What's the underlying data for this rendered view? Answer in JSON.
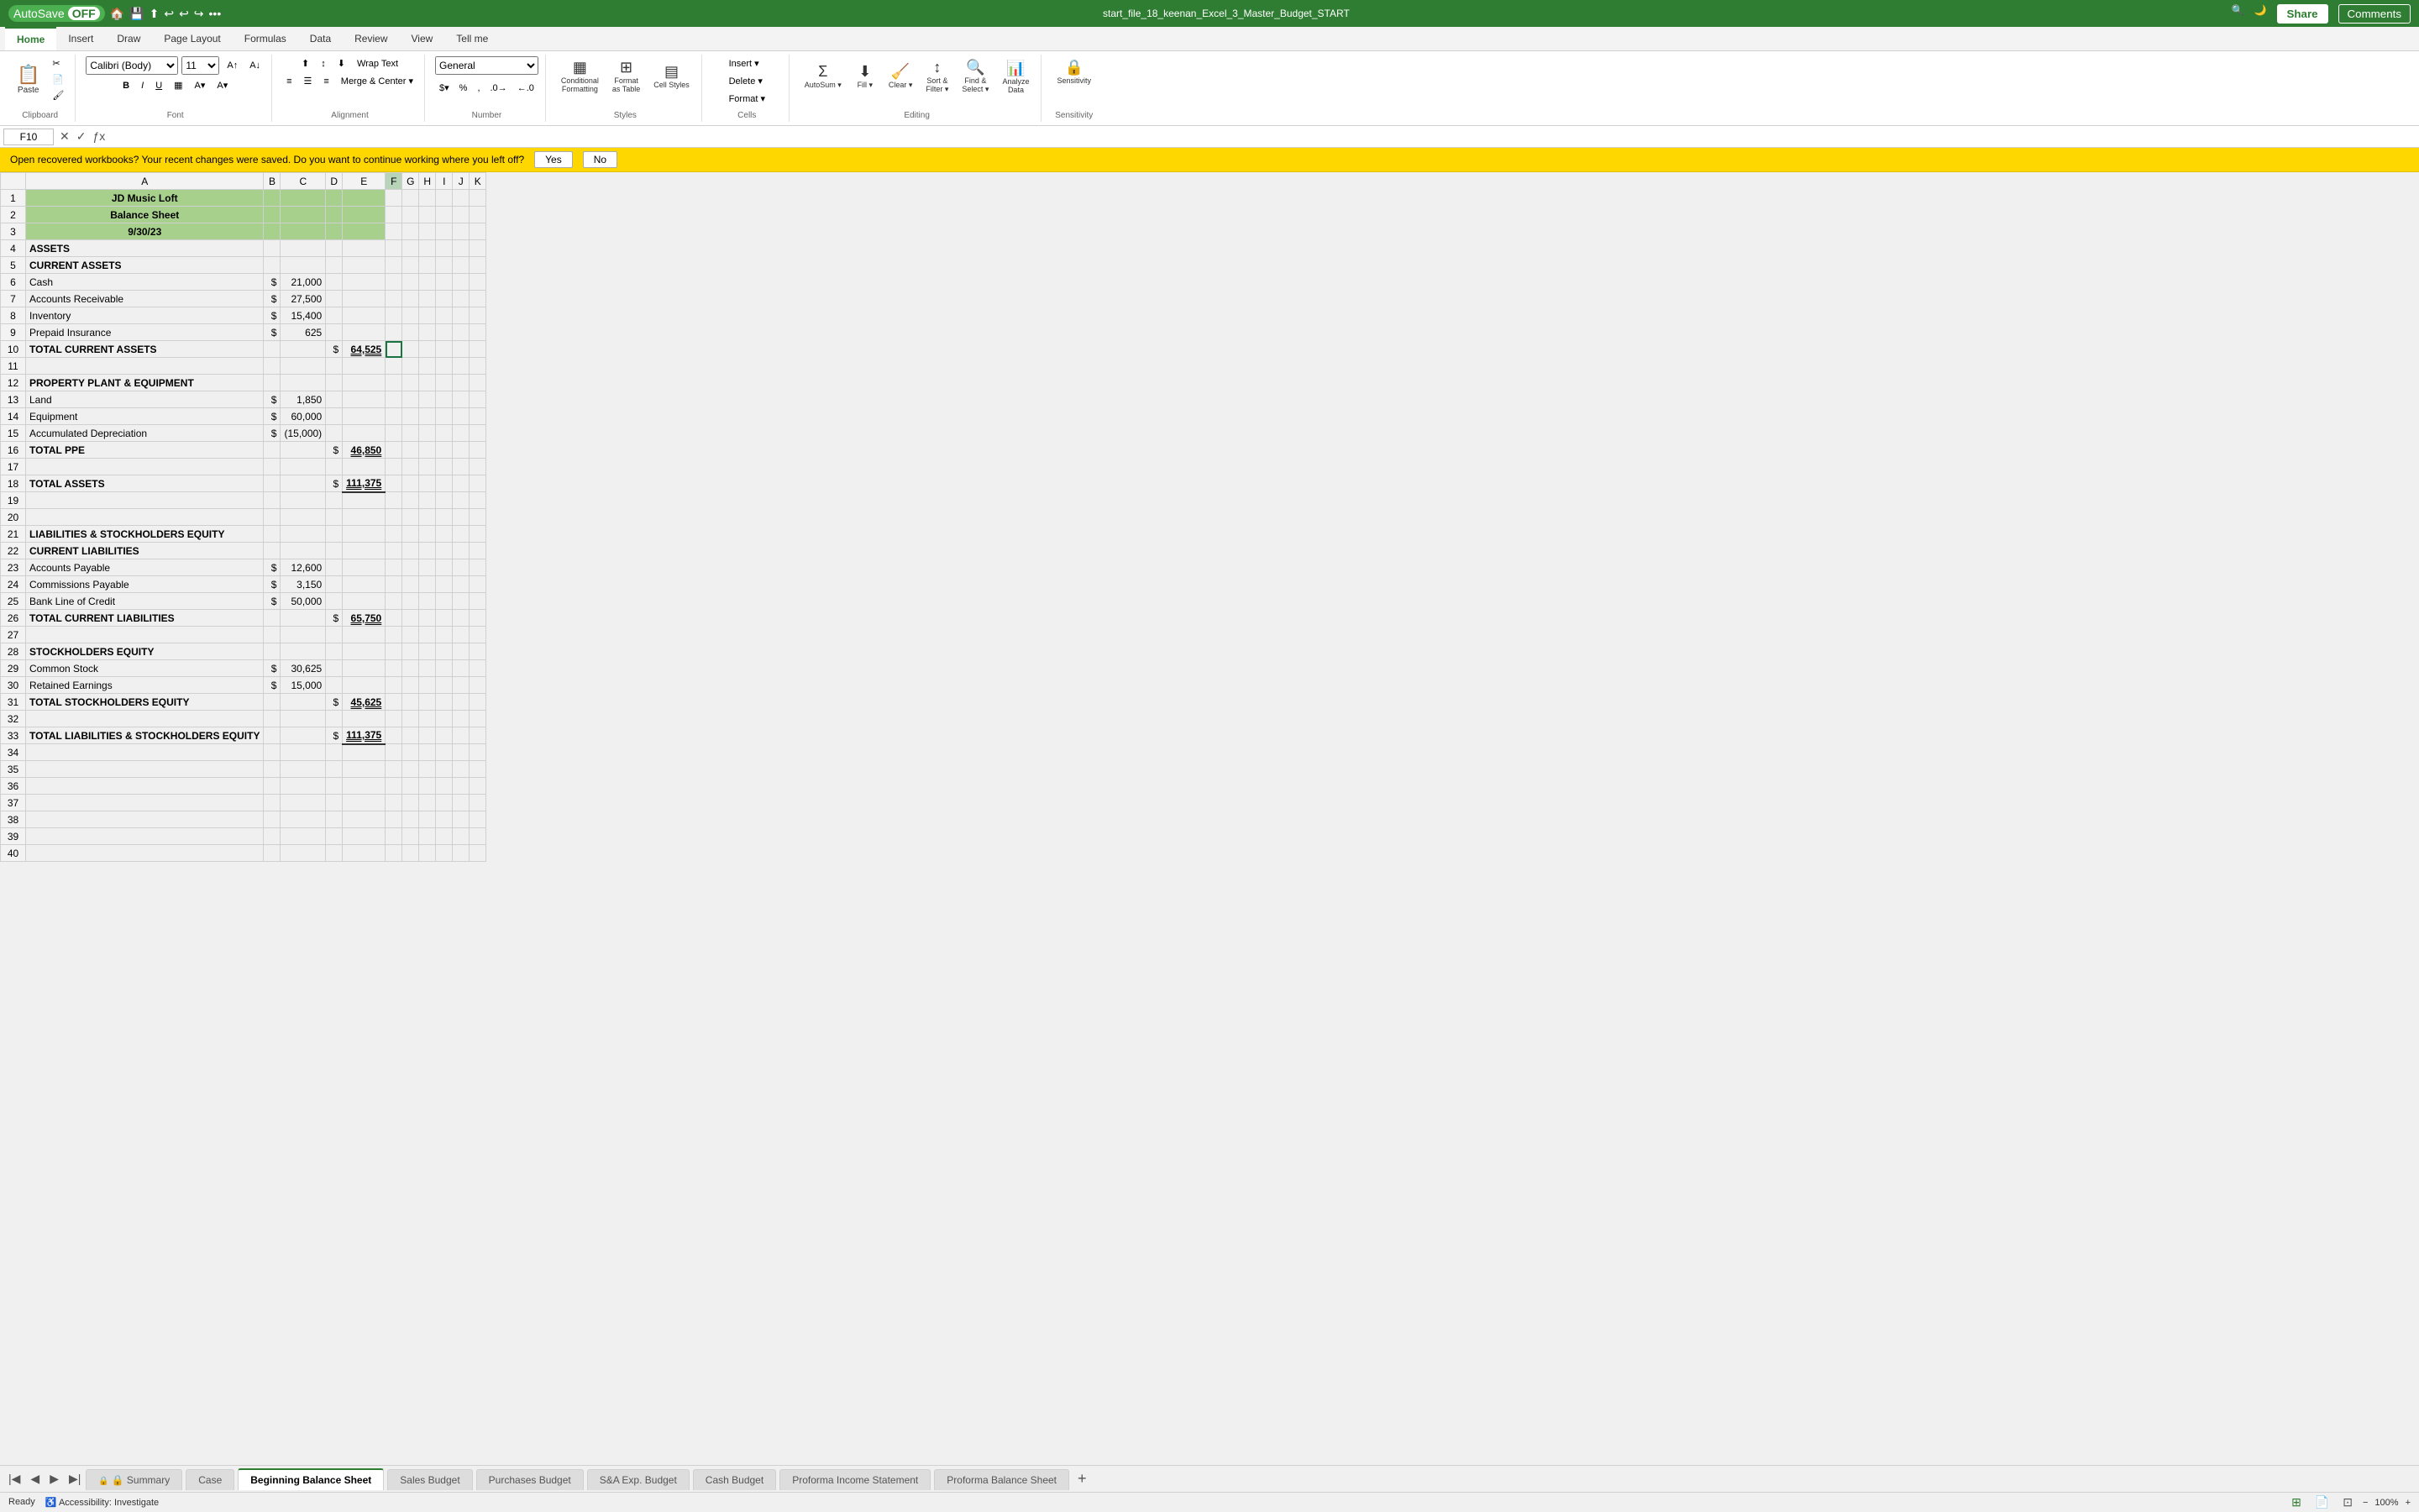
{
  "titlebar": {
    "autosave_label": "AutoSave",
    "autosave_state": "OFF",
    "filename": "start_file_18_keenan_Excel_3_Master_Budget_START",
    "share_label": "Share",
    "comments_label": "Comments"
  },
  "ribbon": {
    "tabs": [
      "Home",
      "Insert",
      "Draw",
      "Page Layout",
      "Formulas",
      "Data",
      "Review",
      "View",
      "Tell me"
    ],
    "active_tab": "Home",
    "groups": {
      "clipboard": "Clipboard",
      "font": "Font",
      "alignment": "Alignment",
      "number": "Number",
      "styles": "Styles",
      "cells": "Cells",
      "editing": "Editing",
      "sensitivity": "Sensitivity"
    },
    "buttons": {
      "paste": "Paste",
      "wrap_text": "Wrap Text",
      "merge_center": "Merge & Center",
      "conditional_formatting": "Conditional Formatting",
      "format_as_table": "Format as Table",
      "cell_styles": "Cell Styles",
      "insert": "Insert",
      "delete": "Delete",
      "format": "Format",
      "sort_filter": "Sort & Filter",
      "find_select": "Find & Select",
      "analyze_data": "Analyze Data",
      "sensitivity": "Sensitivity"
    }
  },
  "formulabar": {
    "cell_ref": "F10",
    "formula": ""
  },
  "notification": {
    "text": "Open recovered workbooks?  Your recent changes were saved. Do you want to continue working where you left off?",
    "yes_label": "Yes",
    "no_label": "No"
  },
  "sheet": {
    "columns": [
      "A",
      "B",
      "C",
      "D",
      "E",
      "F",
      "G",
      "H",
      "I",
      "J",
      "K"
    ],
    "rows": [
      {
        "num": 1,
        "cells": {
          "A": "JD Music Loft",
          "A_align": "center",
          "A_bold": true,
          "A_colspan": 5,
          "bg": "header-green"
        }
      },
      {
        "num": 2,
        "cells": {
          "A": "Balance Sheet",
          "A_align": "center",
          "A_bold": true,
          "A_colspan": 5,
          "bg": "header-green"
        }
      },
      {
        "num": 3,
        "cells": {
          "A": "9/30/23",
          "A_align": "center",
          "A_bold": true,
          "A_colspan": 5,
          "bg": "header-green"
        }
      },
      {
        "num": 4,
        "cells": {
          "A": "ASSETS",
          "A_bold": true
        }
      },
      {
        "num": 5,
        "cells": {
          "A": "CURRENT ASSETS",
          "A_bold": true
        }
      },
      {
        "num": 6,
        "cells": {
          "A": "Cash",
          "B": "$",
          "B_align": "right",
          "C": "21,000",
          "C_align": "right"
        }
      },
      {
        "num": 7,
        "cells": {
          "A": "Accounts Receivable",
          "B": "$",
          "B_align": "right",
          "C": "27,500",
          "C_align": "right"
        }
      },
      {
        "num": 8,
        "cells": {
          "A": "Inventory",
          "B": "$",
          "B_align": "right",
          "C": "15,400",
          "C_align": "right"
        }
      },
      {
        "num": 9,
        "cells": {
          "A": "Prepaid Insurance",
          "B": "$",
          "B_align": "right",
          "C": "625",
          "C_align": "right"
        }
      },
      {
        "num": 10,
        "cells": {
          "A": "TOTAL CURRENT ASSETS",
          "A_bold": true,
          "D": "$",
          "D_align": "right",
          "E": "64,525",
          "E_align": "right",
          "E_bold": true,
          "E_underline": true
        }
      },
      {
        "num": 11,
        "cells": {}
      },
      {
        "num": 12,
        "cells": {
          "A": "PROPERTY PLANT & EQUIPMENT",
          "A_bold": true
        }
      },
      {
        "num": 13,
        "cells": {
          "A": "Land",
          "B": "$",
          "B_align": "right",
          "C": "1,850",
          "C_align": "right"
        }
      },
      {
        "num": 14,
        "cells": {
          "A": "Equipment",
          "B": "$",
          "B_align": "right",
          "C": "60,000",
          "C_align": "right"
        }
      },
      {
        "num": 15,
        "cells": {
          "A": "Accumulated Depreciation",
          "B": "$",
          "B_align": "right",
          "C": "(15,000)",
          "C_align": "right"
        }
      },
      {
        "num": 16,
        "cells": {
          "A": "TOTAL PPE",
          "A_bold": true,
          "D": "$",
          "D_align": "right",
          "E": "46,850",
          "E_align": "right",
          "E_bold": true,
          "E_underline": true
        }
      },
      {
        "num": 17,
        "cells": {}
      },
      {
        "num": 18,
        "cells": {
          "A": "TOTAL ASSETS",
          "A_bold": true,
          "D": "$",
          "D_align": "right",
          "E": "111,375",
          "E_align": "right",
          "E_bold": true,
          "E_underline": true
        }
      },
      {
        "num": 19,
        "cells": {}
      },
      {
        "num": 20,
        "cells": {}
      },
      {
        "num": 21,
        "cells": {
          "A": "LIABILITIES & STOCKHOLDERS EQUITY",
          "A_bold": true
        }
      },
      {
        "num": 22,
        "cells": {
          "A": "CURRENT LIABILITIES",
          "A_bold": true
        }
      },
      {
        "num": 23,
        "cells": {
          "A": "Accounts Payable",
          "B": "$",
          "B_align": "right",
          "C": "12,600",
          "C_align": "right"
        }
      },
      {
        "num": 24,
        "cells": {
          "A": "Commissions Payable",
          "B": "$",
          "B_align": "right",
          "C": "3,150",
          "C_align": "right"
        }
      },
      {
        "num": 25,
        "cells": {
          "A": "Bank Line of Credit",
          "B": "$",
          "B_align": "right",
          "C": "50,000",
          "C_align": "right"
        }
      },
      {
        "num": 26,
        "cells": {
          "A": "TOTAL CURRENT LIABILITIES",
          "A_bold": true,
          "D": "$",
          "D_align": "right",
          "E": "65,750",
          "E_align": "right",
          "E_bold": true,
          "E_underline": true
        }
      },
      {
        "num": 27,
        "cells": {}
      },
      {
        "num": 28,
        "cells": {
          "A": "STOCKHOLDERS EQUITY",
          "A_bold": true
        }
      },
      {
        "num": 29,
        "cells": {
          "A": "Common Stock",
          "B": "$",
          "B_align": "right",
          "C": "30,625",
          "C_align": "right"
        }
      },
      {
        "num": 30,
        "cells": {
          "A": "Retained Earnings",
          "B": "$",
          "B_align": "right",
          "C": "15,000",
          "C_align": "right"
        }
      },
      {
        "num": 31,
        "cells": {
          "A": "TOTAL STOCKHOLDERS EQUITY",
          "A_bold": true,
          "D": "$",
          "D_align": "right",
          "E": "45,625",
          "E_align": "right",
          "E_bold": true,
          "E_underline": true
        }
      },
      {
        "num": 32,
        "cells": {}
      },
      {
        "num": 33,
        "cells": {
          "A": "TOTAL LIABILITIES & STOCKHOLDERS EQUITY",
          "A_bold": true,
          "D": "$",
          "D_align": "right",
          "E": "111,375",
          "E_align": "right",
          "E_bold": true,
          "E_underline": true
        }
      },
      {
        "num": 34,
        "cells": {}
      },
      {
        "num": 35,
        "cells": {}
      },
      {
        "num": 36,
        "cells": {}
      },
      {
        "num": 37,
        "cells": {}
      },
      {
        "num": 38,
        "cells": {}
      },
      {
        "num": 39,
        "cells": {}
      },
      {
        "num": 40,
        "cells": {}
      }
    ]
  },
  "sheet_tabs": [
    {
      "label": "Summary",
      "active": false,
      "locked": true
    },
    {
      "label": "Case",
      "active": false,
      "locked": false
    },
    {
      "label": "Beginning Balance Sheet",
      "active": true,
      "locked": false
    },
    {
      "label": "Sales Budget",
      "active": false,
      "locked": false
    },
    {
      "label": "Purchases Budget",
      "active": false,
      "locked": false
    },
    {
      "label": "S&A Exp. Budget",
      "active": false,
      "locked": false
    },
    {
      "label": "Cash Budget",
      "active": false,
      "locked": false
    },
    {
      "label": "Proforma Income Statement",
      "active": false,
      "locked": false
    },
    {
      "label": "Proforma Balance Sheet",
      "active": false,
      "locked": false
    }
  ],
  "statusbar": {
    "status": "Ready",
    "accessibility": "Accessibility: Investigate",
    "zoom": "100%"
  },
  "colors": {
    "accent": "#2e7d32",
    "header_bg": "#a8d08d",
    "cell_selected": "#1a7340"
  }
}
